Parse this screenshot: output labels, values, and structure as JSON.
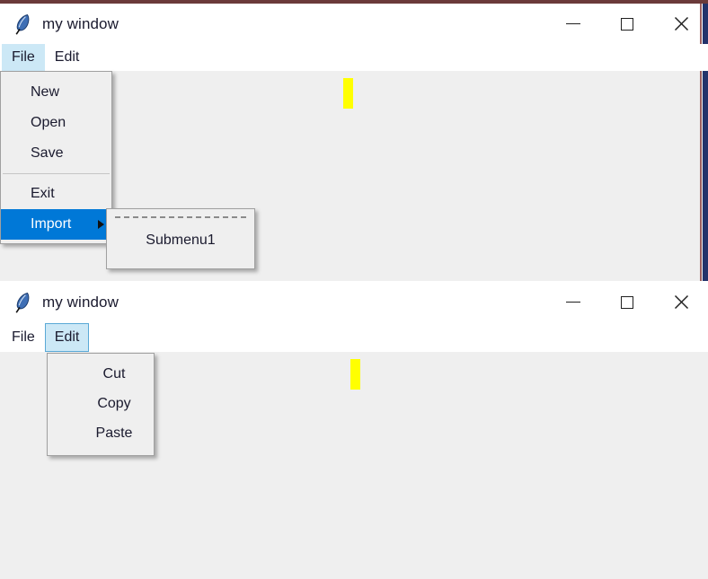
{
  "windows": [
    {
      "title": "my window",
      "icon": "feather-icon",
      "controls": {
        "minimize": "–",
        "maximize": "□",
        "close": "✕"
      },
      "menubar": [
        {
          "label": "File",
          "state": "active"
        },
        {
          "label": "Edit",
          "state": "normal"
        }
      ],
      "open_menu": {
        "name": "File",
        "items": [
          {
            "label": "New",
            "type": "command"
          },
          {
            "label": "Open",
            "type": "command"
          },
          {
            "label": "Save",
            "type": "command"
          },
          {
            "label": "",
            "type": "separator"
          },
          {
            "label": "Exit",
            "type": "command"
          },
          {
            "label": "Import",
            "type": "cascade",
            "state": "highlighted",
            "arrow": "triangle-right-icon"
          }
        ]
      },
      "submenu": {
        "name": "Import",
        "tearoff": true,
        "items": [
          {
            "label": "Submenu1",
            "type": "command"
          }
        ]
      },
      "caret": {
        "color": "#ffff00"
      }
    },
    {
      "title": "my window",
      "icon": "feather-icon",
      "controls": {
        "minimize": "–",
        "maximize": "□",
        "close": "✕"
      },
      "menubar": [
        {
          "label": "File",
          "state": "normal"
        },
        {
          "label": "Edit",
          "state": "active"
        }
      ],
      "open_menu": {
        "name": "Edit",
        "items": [
          {
            "label": "Cut",
            "type": "command"
          },
          {
            "label": "Copy",
            "type": "command"
          },
          {
            "label": "Paste",
            "type": "command"
          }
        ]
      },
      "caret": {
        "color": "#ffff00"
      }
    }
  ],
  "colors": {
    "menu_highlight": "#0078d7",
    "menubar_active": "#cce8f6",
    "client_background": "#efefef",
    "titlebar_background": "#ffffff",
    "caret": "#ffff00",
    "top_border": "#6b3a3a",
    "edge_blue": "#23336b",
    "edge_red": "#9b5f5f",
    "text": "#1a1a2e"
  }
}
